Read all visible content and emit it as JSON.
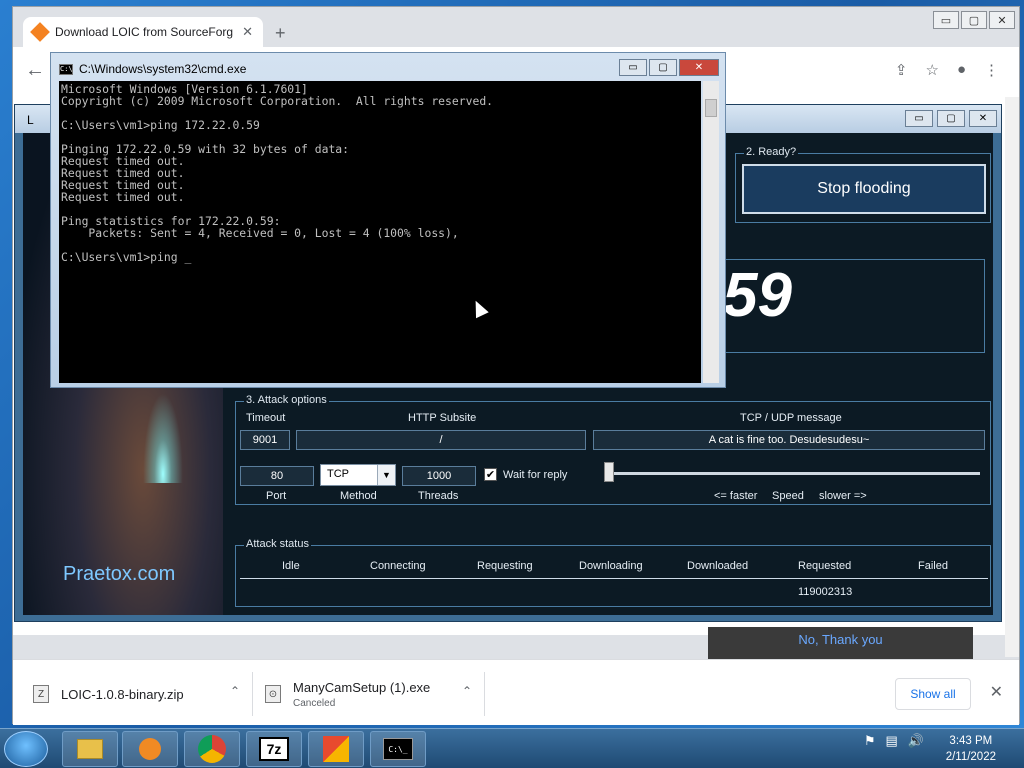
{
  "chrome": {
    "tab_title": "Download LOIC from SourceForg",
    "tab_close": "✕",
    "new_tab": "+",
    "win_min": "▭",
    "win_max": "▢",
    "win_close": "✕",
    "back_icon": "←",
    "icons": {
      "share": "⇪",
      "star": "☆",
      "profile": "●",
      "menu": "⋮"
    },
    "page_button": "No, Thank you"
  },
  "downloads": {
    "items": [
      {
        "name": "LOIC-1.0.8-binary.zip",
        "status": "",
        "icon": "Z"
      },
      {
        "name": "ManyCamSetup (1).exe",
        "status": "Canceled",
        "icon": "⊙"
      }
    ],
    "chevron": "⌃",
    "show_all": "Show all",
    "close": "✕"
  },
  "loic": {
    "title": "L",
    "ready_group": "2. Ready?",
    "stop_button": "Stop flooding",
    "big_number": "59",
    "brand": "Praetox.com",
    "attack_options": {
      "group_title": "3. Attack options",
      "timeout_label": "Timeout",
      "timeout_value": "9001",
      "http_label": "HTTP Subsite",
      "http_value": "/",
      "msg_label": "TCP / UDP message",
      "msg_value": "A cat is fine too. Desudesudesu~",
      "port_value": "80",
      "port_label": "Port",
      "method_value": "TCP",
      "method_label": "Method",
      "threads_value": "1000",
      "threads_label": "Threads",
      "wait_label": "Wait for reply",
      "wait_checked": "✔",
      "speed_faster": "<= faster",
      "speed_label": "Speed",
      "speed_slower": "slower =>",
      "speed_level": 0.0
    },
    "attack_status": {
      "group_title": "Attack status",
      "columns": [
        "Idle",
        "Connecting",
        "Requesting",
        "Downloading",
        "Downloaded",
        "Requested",
        "Failed"
      ],
      "requested_value": "119002313"
    }
  },
  "cmd": {
    "title": "C:\\Windows\\system32\\cmd.exe",
    "icon_text": "C:\\",
    "lines": [
      "Microsoft Windows [Version 6.1.7601]",
      "Copyright (c) 2009 Microsoft Corporation.  All rights reserved.",
      "",
      "C:\\Users\\vm1>ping 172.22.0.59",
      "",
      "Pinging 172.22.0.59 with 32 bytes of data:",
      "Request timed out.",
      "Request timed out.",
      "Request timed out.",
      "Request timed out.",
      "",
      "Ping statistics for 172.22.0.59:",
      "    Packets: Sent = 4, Received = 0, Lost = 4 (100% loss),",
      "",
      "C:\\Users\\vm1>ping _"
    ]
  },
  "taskbar": {
    "apps": [
      "explorer",
      "media-player",
      "chrome",
      "7z",
      "office",
      "cmd"
    ],
    "sevenzip_label": "7z",
    "cmd_label": "C:\\_",
    "tray": {
      "flag": "⚑",
      "network": "▤",
      "volume": "🔊"
    },
    "time": "3:43 PM",
    "date": "2/11/2022"
  }
}
